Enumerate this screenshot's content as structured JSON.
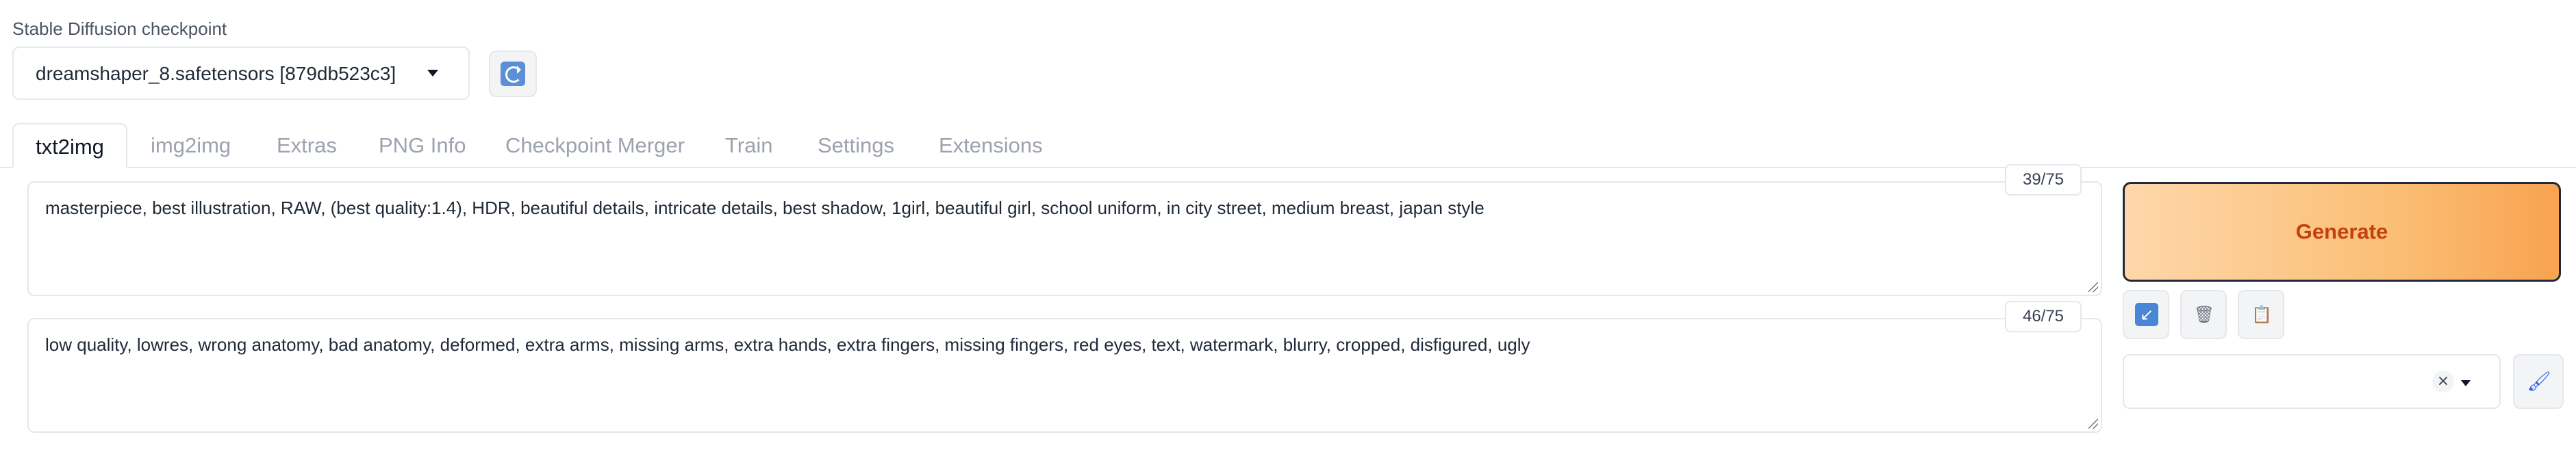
{
  "checkpoint": {
    "label": "Stable Diffusion checkpoint",
    "selected": "dreamshaper_8.safetensors [879db523c3]",
    "refresh_icon": "refresh-icon"
  },
  "tabs": [
    {
      "label": "txt2img",
      "active": true
    },
    {
      "label": "img2img",
      "active": false
    },
    {
      "label": "Extras",
      "active": false
    },
    {
      "label": "PNG Info",
      "active": false
    },
    {
      "label": "Checkpoint Merger",
      "active": false
    },
    {
      "label": "Train",
      "active": false
    },
    {
      "label": "Settings",
      "active": false
    },
    {
      "label": "Extensions",
      "active": false
    }
  ],
  "prompt": {
    "text": "masterpiece, best illustration, RAW, (best quality:1.4), HDR, beautiful details, intricate details, best shadow, 1girl, beautiful girl, school uniform, in city street, medium breast, japan style",
    "token_count": "39/75"
  },
  "negative_prompt": {
    "text": "low quality, lowres, wrong anatomy, bad anatomy, deformed, extra arms, missing arms, extra hands, extra fingers, missing fingers, red eyes, text, watermark, blurry, cropped, disfigured, ugly",
    "token_count": "46/75"
  },
  "actions": {
    "generate_label": "Generate",
    "tool_icons": [
      "read-params-icon",
      "trash-icon",
      "clipboard-icon"
    ],
    "style_clear": "×",
    "apply_styles_icon": "paintbrush-icon"
  },
  "colors": {
    "generate_from": "#fed7aa",
    "generate_to": "#f8a350",
    "generate_text": "#c2410c"
  }
}
